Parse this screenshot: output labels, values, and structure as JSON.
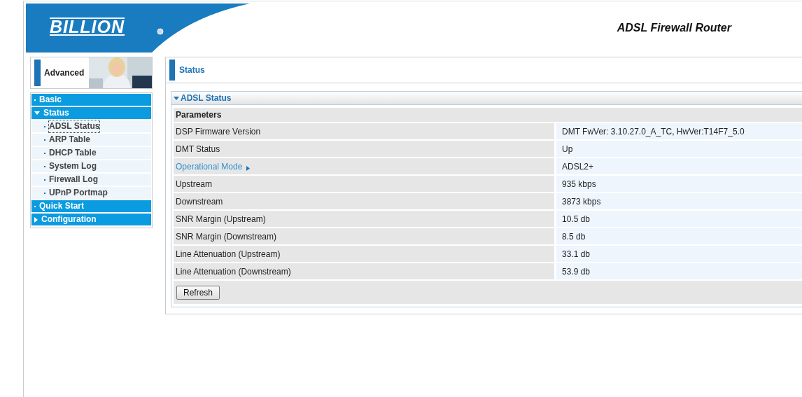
{
  "header": {
    "logo": "BILLION",
    "product": "ADSL Firewall Router"
  },
  "sidebar": {
    "banner": "Advanced",
    "items": [
      {
        "label": "Basic",
        "kind": "leaf"
      },
      {
        "label": "Status",
        "kind": "folder",
        "expanded": true,
        "children": [
          {
            "label": "ADSL Status",
            "selected": true
          },
          {
            "label": "ARP Table",
            "selected": false
          },
          {
            "label": "DHCP Table",
            "selected": false
          },
          {
            "label": "System Log",
            "selected": false
          },
          {
            "label": "Firewall Log",
            "selected": false
          },
          {
            "label": "UPnP Portmap",
            "selected": false
          }
        ]
      },
      {
        "label": "Quick Start",
        "kind": "leaf"
      },
      {
        "label": "Configuration",
        "kind": "folder",
        "expanded": false
      }
    ]
  },
  "page_title": "Status",
  "section": {
    "title": "ADSL Status",
    "expanded": true,
    "heading": "Parameters",
    "rows": [
      {
        "label": "DSP Firmware Version",
        "value": "DMT FwVer: 3.10.27.0_A_TC, HwVer:T14F7_5.0",
        "kind": "plain"
      },
      {
        "label": "DMT Status",
        "value": "Up",
        "kind": "plain"
      },
      {
        "label": "Operational Mode",
        "value": "ADSL2+",
        "kind": "link"
      },
      {
        "label": "Upstream",
        "value": "935 kbps",
        "kind": "plain"
      },
      {
        "label": "Downstream",
        "value": "3873 kbps",
        "kind": "plain"
      },
      {
        "label": "SNR Margin (Upstream)",
        "value": "10.5 db",
        "kind": "plain"
      },
      {
        "label": "SNR Margin (Downstream)",
        "value": "8.5 db",
        "kind": "plain"
      },
      {
        "label": "Line Attenuation (Upstream)",
        "value": "33.1 db",
        "kind": "plain"
      },
      {
        "label": "Line Attenuation (Downstream)",
        "value": "53.9 db",
        "kind": "plain"
      }
    ],
    "button": "Refresh"
  }
}
